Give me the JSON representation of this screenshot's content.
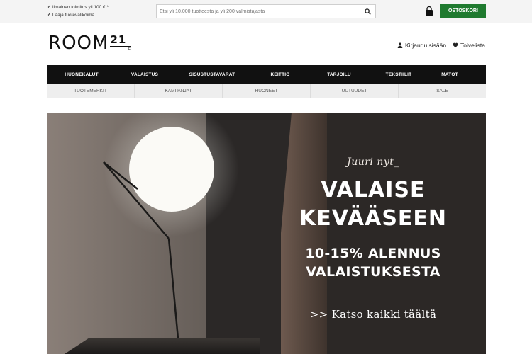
{
  "topbar": {
    "usps": [
      "Ilmainen toimitus yli 100 € *",
      "Laaja tuotevalikoima"
    ],
    "search_placeholder": "Etsi yli 10.000 tuotteesta ja yli 200 valmistajasta",
    "cart_label": "OSTOSKORI"
  },
  "header": {
    "logo_text": "ROOM",
    "logo_number": "21",
    "logo_suffix": ".FI",
    "login_label": "Kirjaudu sisään",
    "wishlist_label": "Toivelista"
  },
  "main_nav": [
    "HUONEKALUT",
    "VALAISTUS",
    "SISUSTUSTAVARAT",
    "KEITTIÖ",
    "TARJOILU",
    "TEKSTIILIT",
    "MATOT"
  ],
  "sub_nav": [
    "TUOTEMERKIT",
    "KAMPANJAT",
    "HUONEET",
    "UUTUUDET",
    "SALE"
  ],
  "hero": {
    "kicker": "Juuri nyt_",
    "headline_line1": "VALAISE",
    "headline_line2": "KEVÄÄSEEN",
    "sub_line1": "10-15% ALENNUS",
    "sub_line2": "VALAISTUKSESTA",
    "cta": ">> Katso kaikki täältä"
  },
  "colors": {
    "cart_button": "#1f7a2f",
    "nav_bg": "#111111",
    "subnav_bg": "#eeeeee"
  }
}
